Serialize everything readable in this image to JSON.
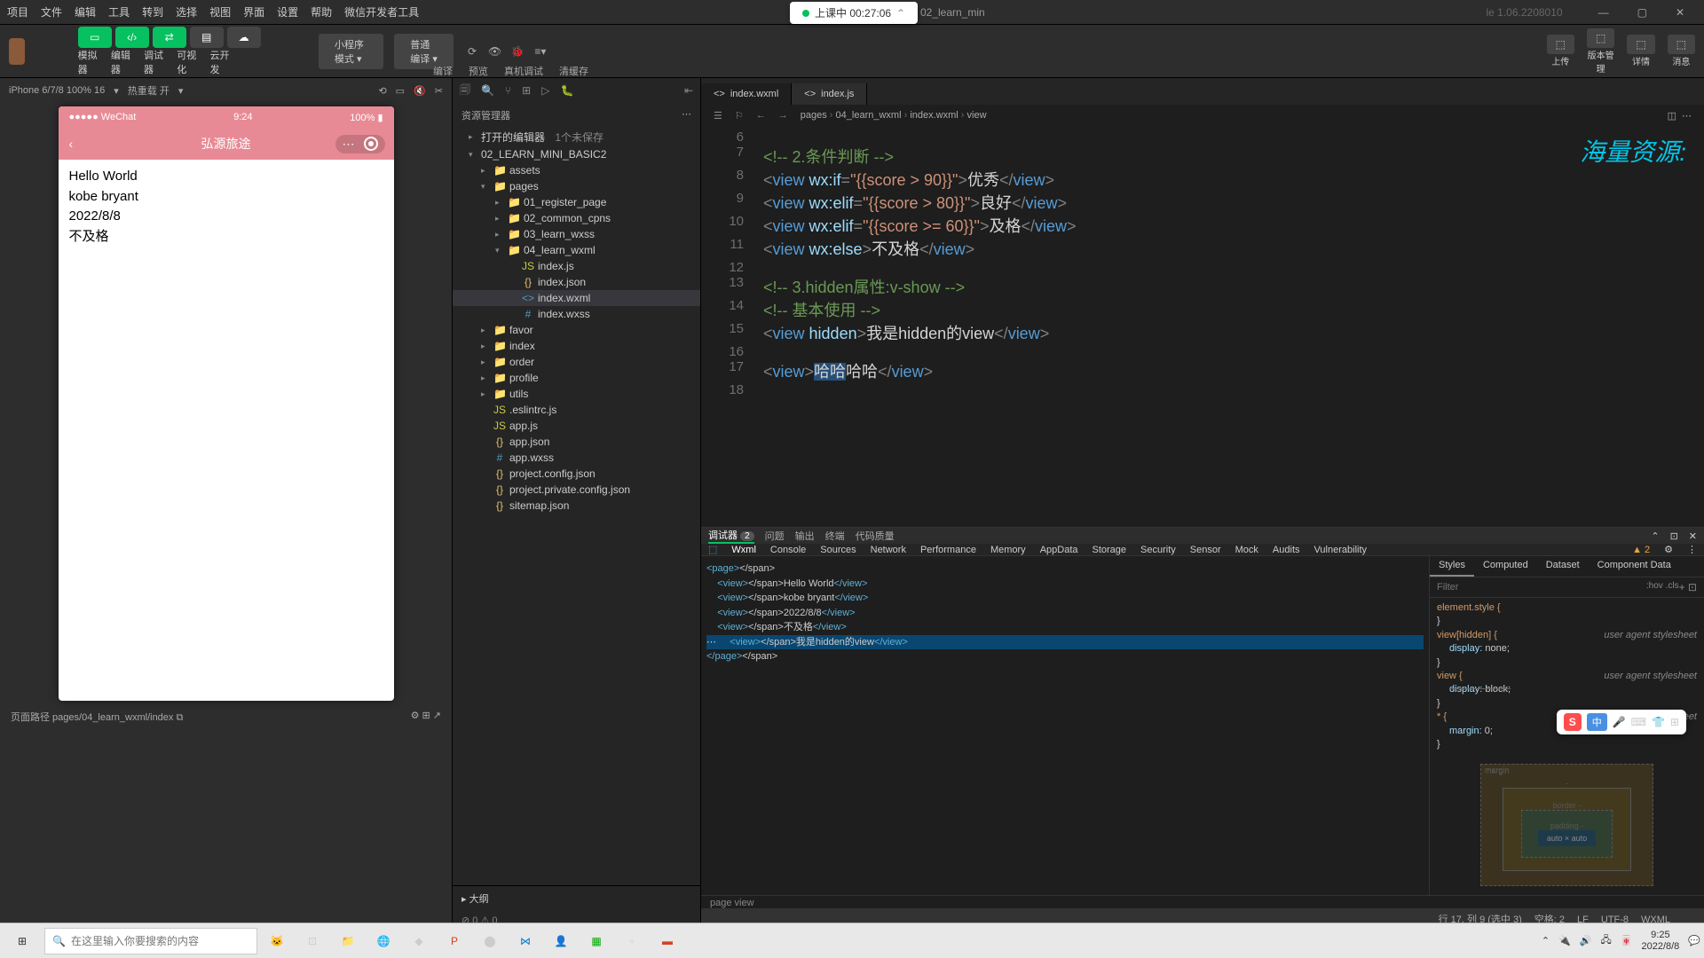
{
  "menu": {
    "items": [
      "项目",
      "文件",
      "编辑",
      "工具",
      "转到",
      "选择",
      "视图",
      "界面",
      "设置",
      "帮助",
      "微信开发者工具"
    ],
    "title": "02_learn_min",
    "version": "le 1.06.2208010"
  },
  "pill": {
    "text": "上课中 00:27:06"
  },
  "topbar": {
    "modelabels": [
      "模拟器",
      "编辑器",
      "调试器",
      "可视化",
      "云开发"
    ],
    "select1": "小程序模式",
    "select2": "普通编译",
    "actions": [
      "编译",
      "预览",
      "真机调试",
      "清缓存"
    ],
    "right": [
      "上传",
      "版本管理",
      "详情",
      "消息"
    ]
  },
  "sim": {
    "device": "iPhone 6/7/8 100% 16",
    "hot": "热重载 开",
    "status_left": "●●●●● WeChat",
    "status_time": "9:24",
    "status_right": "100%",
    "navtitle": "弘源旅途",
    "lines": [
      "Hello World",
      "kobe bryant",
      "2022/8/8",
      "不及格"
    ]
  },
  "explorer": {
    "title": "资源管理器",
    "open": "打开的编辑器",
    "open_badge": "1个未保存",
    "root": "02_LEARN_MINI_BASIC2",
    "tree": [
      {
        "n": "assets",
        "t": "folder",
        "d": 2
      },
      {
        "n": "pages",
        "t": "folder",
        "d": 2,
        "open": true
      },
      {
        "n": "01_register_page",
        "t": "folder",
        "d": 3
      },
      {
        "n": "02_common_cpns",
        "t": "folder",
        "d": 3
      },
      {
        "n": "03_learn_wxss",
        "t": "folder",
        "d": 3
      },
      {
        "n": "04_learn_wxml",
        "t": "folder",
        "d": 3,
        "open": true
      },
      {
        "n": "index.js",
        "t": "js",
        "d": 4
      },
      {
        "n": "index.json",
        "t": "json",
        "d": 4
      },
      {
        "n": "index.wxml",
        "t": "wxml",
        "d": 4,
        "active": true
      },
      {
        "n": "index.wxss",
        "t": "wxss",
        "d": 4
      },
      {
        "n": "favor",
        "t": "folder",
        "d": 2
      },
      {
        "n": "index",
        "t": "folder",
        "d": 2
      },
      {
        "n": "order",
        "t": "folder",
        "d": 2
      },
      {
        "n": "profile",
        "t": "folder",
        "d": 2
      },
      {
        "n": "utils",
        "t": "folder",
        "d": 2
      },
      {
        "n": ".eslintrc.js",
        "t": "js",
        "d": 2
      },
      {
        "n": "app.js",
        "t": "js",
        "d": 2
      },
      {
        "n": "app.json",
        "t": "json",
        "d": 2
      },
      {
        "n": "app.wxss",
        "t": "wxss",
        "d": 2
      },
      {
        "n": "project.config.json",
        "t": "json",
        "d": 2
      },
      {
        "n": "project.private.config.json",
        "t": "json",
        "d": 2
      },
      {
        "n": "sitemap.json",
        "t": "json",
        "d": 2
      }
    ],
    "outline": "大纲"
  },
  "editor": {
    "tabs": [
      {
        "n": "index.wxml",
        "active": true
      },
      {
        "n": "index.js"
      }
    ],
    "crumb": [
      "pages",
      "04_learn_wxml",
      "index.wxml",
      "view"
    ],
    "watermark": "海量资源:",
    "lines": [
      {
        "n": 6,
        "raw": ""
      },
      {
        "n": 7,
        "type": "comment",
        "raw": "<!-- 2.条件判断 -->"
      },
      {
        "n": 8,
        "type": "tag",
        "p": [
          "<",
          "view",
          " wx:if",
          "=",
          "\"{{score > 90}}\"",
          ">",
          "优秀",
          "</",
          "view",
          ">"
        ]
      },
      {
        "n": 9,
        "type": "tag",
        "p": [
          "<",
          "view",
          " wx:elif",
          "=",
          "\"{{score > 80}}\"",
          ">",
          "良好",
          "</",
          "view",
          ">"
        ]
      },
      {
        "n": 10,
        "type": "tag",
        "p": [
          "<",
          "view",
          " wx:elif",
          "=",
          "\"{{score >= 60}}\"",
          ">",
          "及格",
          "</",
          "view",
          ">"
        ]
      },
      {
        "n": 11,
        "type": "else",
        "p": [
          "<",
          "view",
          " wx:else",
          ">",
          "不及格",
          "</",
          "view",
          ">"
        ]
      },
      {
        "n": 12,
        "raw": ""
      },
      {
        "n": 13,
        "type": "comment",
        "raw": "<!-- 3.hidden属性:v-show -->"
      },
      {
        "n": 14,
        "type": "comment",
        "raw": "<!-- 基本使用 -->"
      },
      {
        "n": 15,
        "type": "hidden",
        "p": [
          "<",
          "view",
          " hidden",
          ">",
          "我是hidden的view",
          "</",
          "view",
          ">"
        ]
      },
      {
        "n": 16,
        "raw": ""
      },
      {
        "n": 17,
        "type": "cursor",
        "p": [
          "<",
          "view",
          ">",
          "哈哈",
          "哈哈",
          "</",
          "view",
          ">"
        ]
      },
      {
        "n": 18,
        "raw": ""
      }
    ]
  },
  "devtools": {
    "tabs1": [
      "调试器",
      "问题",
      "输出",
      "终端",
      "代码质量"
    ],
    "badge1": "2",
    "toolbar": [
      "Wxml",
      "Console",
      "Sources",
      "Network",
      "Performance",
      "Memory",
      "AppData",
      "Storage",
      "Security",
      "Sensor",
      "Mock",
      "Audits",
      "Vulnerability"
    ],
    "warn": "▲ 2",
    "dom": [
      {
        "i": 0,
        "h": "<page>"
      },
      {
        "i": 1,
        "h": "  <view>Hello World</view>"
      },
      {
        "i": 1,
        "h": "  <view>kobe bryant</view>"
      },
      {
        "i": 1,
        "h": "  <view>2022/8/8</view>"
      },
      {
        "i": 1,
        "h": "  <view>不及格</view>"
      },
      {
        "i": 1,
        "h": "  <view>我是hidden的view</view>",
        "sel": true
      },
      {
        "i": 0,
        "h": "</page>"
      }
    ],
    "crumb2": "page   view",
    "styles": {
      "tabs": [
        "Styles",
        "Computed",
        "Dataset",
        "Component Data"
      ],
      "filter": "Filter",
      "cls": ":hov .cls",
      "rules": [
        {
          "sel": "element.style {",
          "props": []
        },
        {
          "sel": "view[hidden] {",
          "ua": "user agent stylesheet",
          "props": [
            [
              "display:",
              "none;"
            ]
          ]
        },
        {
          "sel": "view {",
          "ua": "user agent stylesheet",
          "props": [
            [
              "display:",
              "block;",
              "strike"
            ]
          ]
        },
        {
          "sel": "* {",
          "ua": "user agent stylesheet",
          "props": [
            [
              "margin:",
              "0;"
            ]
          ]
        }
      ],
      "box": "auto × auto"
    }
  },
  "status": {
    "left": "页面路径   pages/04_learn_wxml/index",
    "mid": "⊘ 0 ⚠ 0",
    "right": [
      "行 17, 列 9 (选中 3)",
      "空格: 2",
      "LF",
      "UTF-8",
      "WXML"
    ]
  },
  "taskbar": {
    "search": "在这里输入你要搜索的内容",
    "time": "9:25",
    "date": "2022/8/8"
  }
}
